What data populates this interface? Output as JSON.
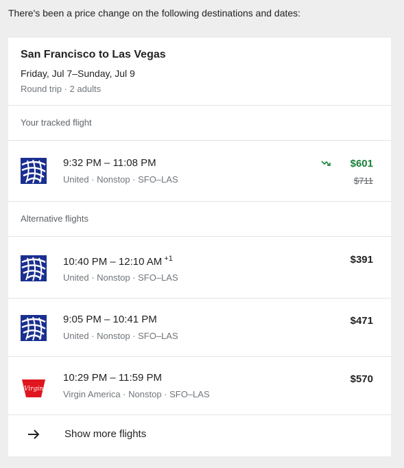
{
  "intro_text": "There's been a price change on the following destinations and dates:",
  "trip": {
    "route": "San Francisco to Las Vegas",
    "dates": "Friday, Jul 7–Sunday, Jul 9",
    "details": "Round trip · 2 adults"
  },
  "tracked": {
    "label": "Your tracked flight",
    "flight": {
      "airline_icon": "united-globe-icon",
      "times": "9:32 PM – 11:08 PM",
      "meta": "United · Nonstop · SFO–LAS",
      "price": "$601",
      "old_price": "$711",
      "trend_icon": "price-down-trend-icon"
    }
  },
  "alternatives": {
    "label": "Alternative flights",
    "flights": [
      {
        "airline_icon": "united-globe-icon",
        "times": "10:40 PM – 12:10 AM",
        "day_offset": "+1",
        "meta": "United · Nonstop · SFO–LAS",
        "price": "$391"
      },
      {
        "airline_icon": "united-globe-icon",
        "times": "9:05 PM – 10:41 PM",
        "meta": "United · Nonstop · SFO–LAS",
        "price": "$471"
      },
      {
        "airline_icon": "virgin-america-icon",
        "times": "10:29 PM – 11:59 PM",
        "meta": "Virgin America · Nonstop · SFO–LAS",
        "price": "$570"
      }
    ]
  },
  "show_more": {
    "label": "Show more flights",
    "icon": "arrow-right-icon"
  },
  "colors": {
    "price_drop": "#188038",
    "united_blue": "#1a2f8f",
    "virgin_red": "#e0161e"
  }
}
